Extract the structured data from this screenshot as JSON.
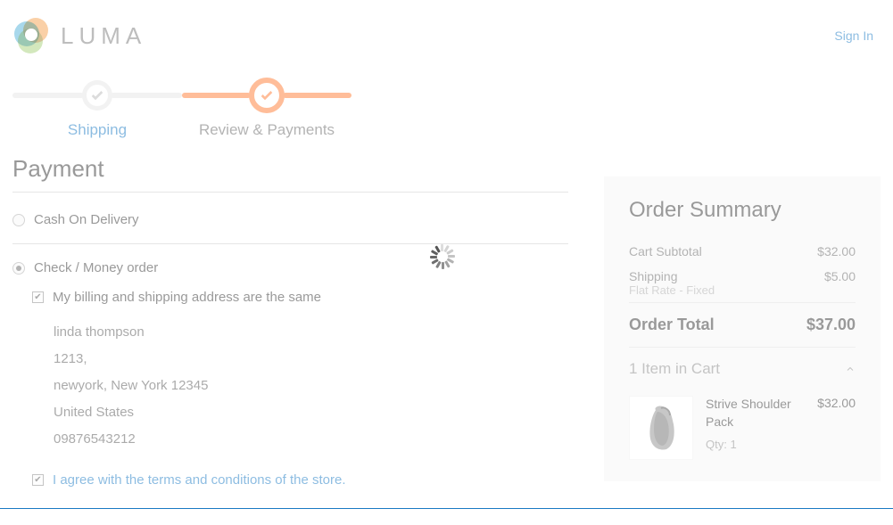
{
  "header": {
    "brand": "LUMA",
    "signin": "Sign In"
  },
  "steps": {
    "shipping": "Shipping",
    "review": "Review & Payments"
  },
  "page": {
    "title": "Payment"
  },
  "methods": {
    "cod": "Cash On Delivery",
    "check": "Check / Money order"
  },
  "billing": {
    "same_label": "My billing and shipping address are the same",
    "name": "linda thompson",
    "street": "1213,",
    "city_line": "newyork, New York 12345",
    "country": "United States",
    "phone": "09876543212",
    "terms_label": "I agree with the terms and conditions of the store."
  },
  "summary": {
    "title": "Order Summary",
    "subtotal_label": "Cart Subtotal",
    "subtotal_value": "$32.00",
    "shipping_label": "Shipping",
    "shipping_value": "$5.00",
    "shipping_method": "Flat Rate - Fixed",
    "total_label": "Order Total",
    "total_value": "$37.00",
    "cart_count": "1 Item in Cart"
  },
  "item": {
    "name": "Strive Shoulder Pack",
    "qty": "Qty: 1",
    "price": "$32.00"
  }
}
